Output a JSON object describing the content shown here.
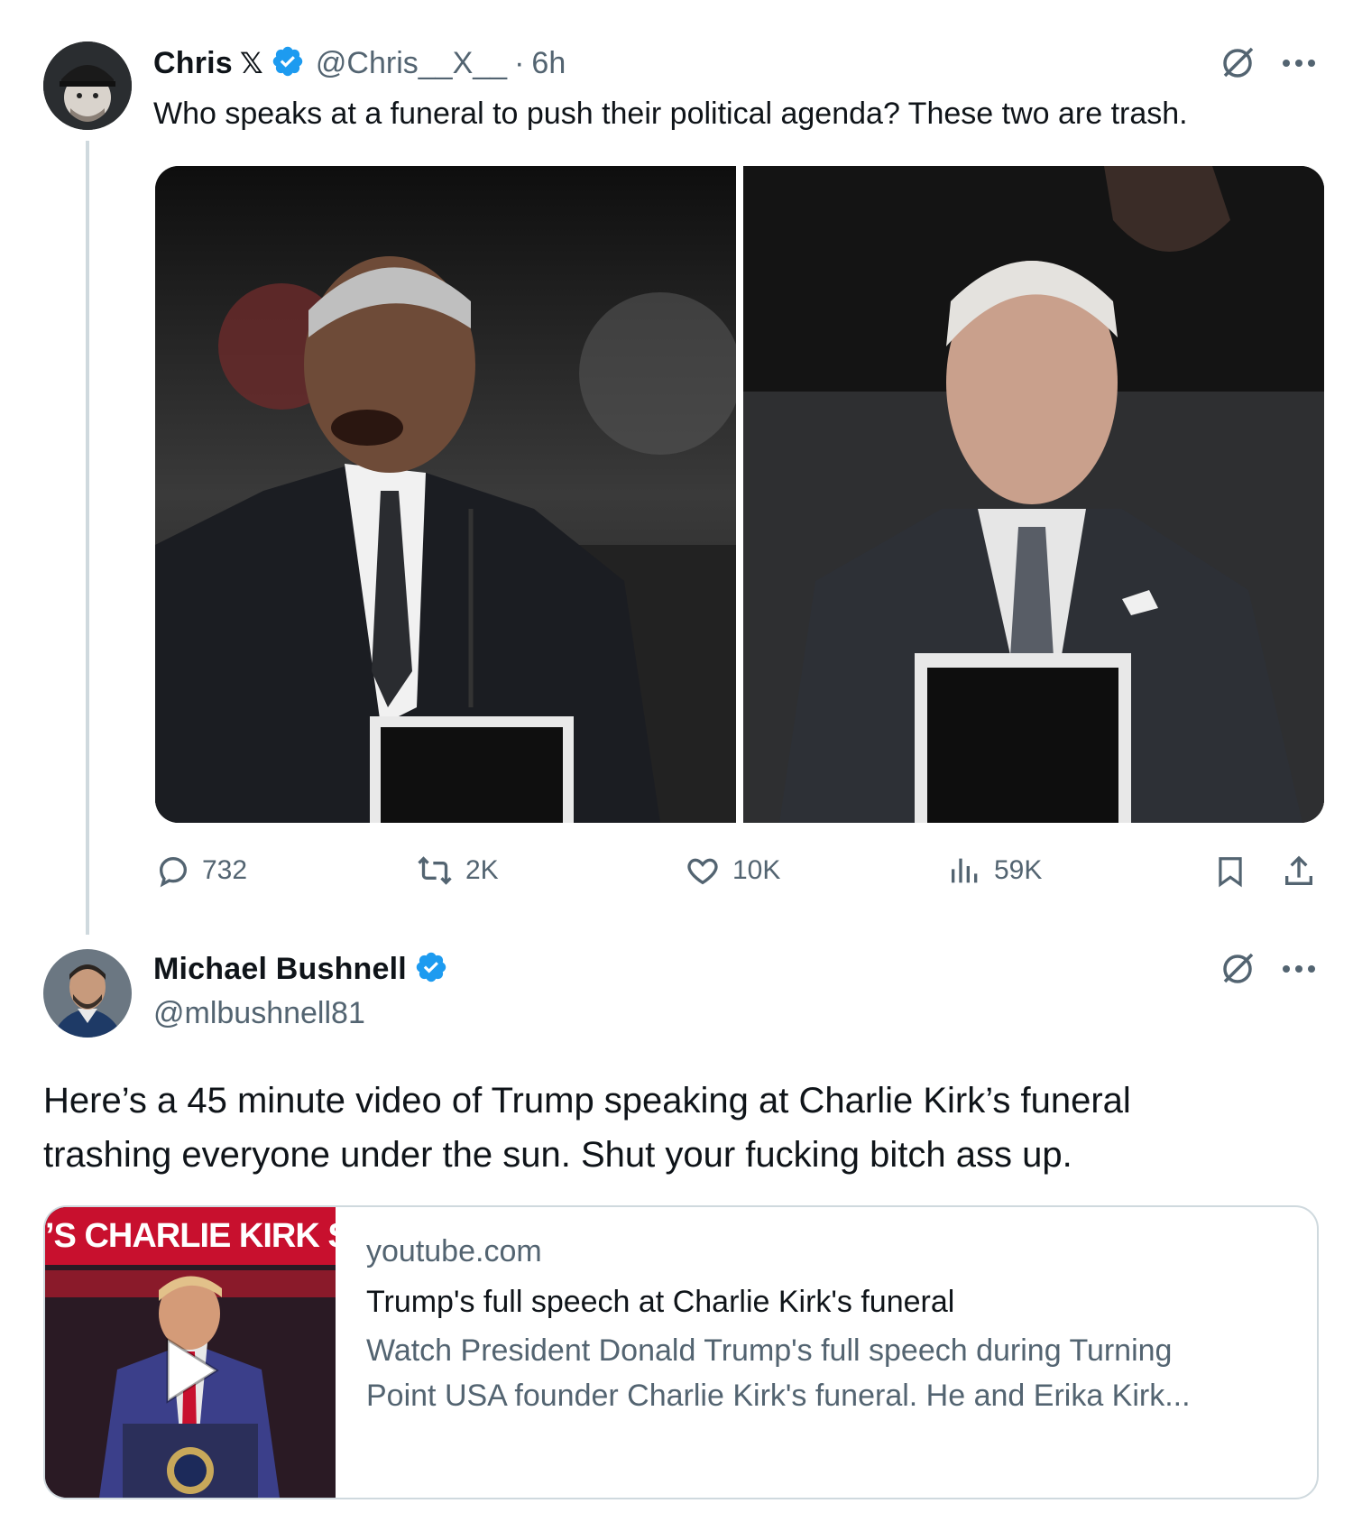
{
  "tweet1": {
    "author_name": "Chris",
    "author_x_mark": "𝕏",
    "handle": "@Chris__X__",
    "time_sep": "·",
    "time": "6h",
    "text": "Who speaks at a funeral to push their political agenda? These two are trash.",
    "actions": {
      "replies": "732",
      "reposts": "2K",
      "likes": "10K",
      "views": "59K"
    }
  },
  "tweet2": {
    "author_name": "Michael Bushnell",
    "handle": "@mlbushnell81",
    "text_line1": "Here’s a 45 minute video of Trump speaking at Charlie Kirk’s funeral",
    "text_line2": "trashing everyone under the sun.  Shut your fucking bitch ass up.",
    "card": {
      "thumb_banner": "’S CHARLIE KIRK SI",
      "domain": "youtube.com",
      "title": "Trump's full speech at Charlie Kirk's funeral",
      "desc_line1": "Watch President Donald Trump's full speech during Turning",
      "desc_line2": "Point USA founder Charlie Kirk's funeral. He and Erika Kirk..."
    }
  },
  "colors": {
    "verified": "#1d9bf0",
    "text": "#0f1419",
    "secondary": "#536471",
    "border": "#cfd9de",
    "banner_red": "#c8102e"
  },
  "icons": [
    "grok-icon",
    "more-icon",
    "reply-icon",
    "repost-icon",
    "like-icon",
    "views-icon",
    "bookmark-icon",
    "share-icon",
    "verified-icon",
    "play-icon"
  ]
}
